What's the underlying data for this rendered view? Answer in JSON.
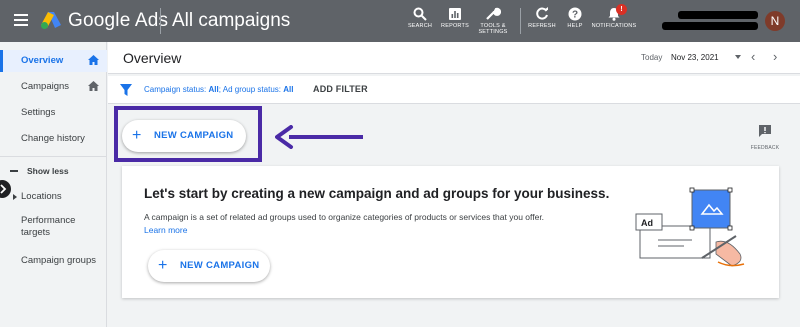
{
  "app": {
    "brand": "Google Ads",
    "page_heading": "All campaigns"
  },
  "toolbar": {
    "search_label": "SEARCH",
    "reports_label": "REPORTS",
    "tools_label_line1": "TOOLS &",
    "tools_label_line2": "SETTINGS",
    "refresh_label": "REFRESH",
    "help_label": "HELP",
    "notifications_label": "NOTIFICATIONS",
    "notifications_badge": "!",
    "avatar_initial": "N"
  },
  "sidebar": {
    "items": [
      {
        "label": "Overview"
      },
      {
        "label": "Campaigns"
      },
      {
        "label": "Settings"
      },
      {
        "label": "Change history"
      },
      {
        "label": "Show less"
      },
      {
        "label": "Locations"
      },
      {
        "label": "Performance"
      },
      {
        "label": "targets"
      },
      {
        "label": "Campaign groups"
      }
    ]
  },
  "overview": {
    "title": "Overview",
    "date_label": "Today",
    "date_value": "Nov 23, 2021"
  },
  "filter": {
    "status_prefix": "Campaign status: ",
    "status_value": "All",
    "sep": "; ",
    "group_prefix": "Ad group status: ",
    "group_value": "All",
    "add_filter": "ADD FILTER"
  },
  "actions": {
    "new_campaign": "NEW CAMPAIGN",
    "feedback": "FEEDBACK"
  },
  "card": {
    "title": "Let's start by creating a new campaign and ad groups for your business.",
    "description": "A campaign is a set of related ad groups used to organize categories of products or services that you offer.",
    "link": "Learn more",
    "button": "NEW CAMPAIGN",
    "illustration_label": "Ad"
  },
  "colors": {
    "topbar": "#5f6368",
    "accent": "#1a73e8",
    "highlight": "#4a2aa6",
    "badge": "#d93025"
  }
}
